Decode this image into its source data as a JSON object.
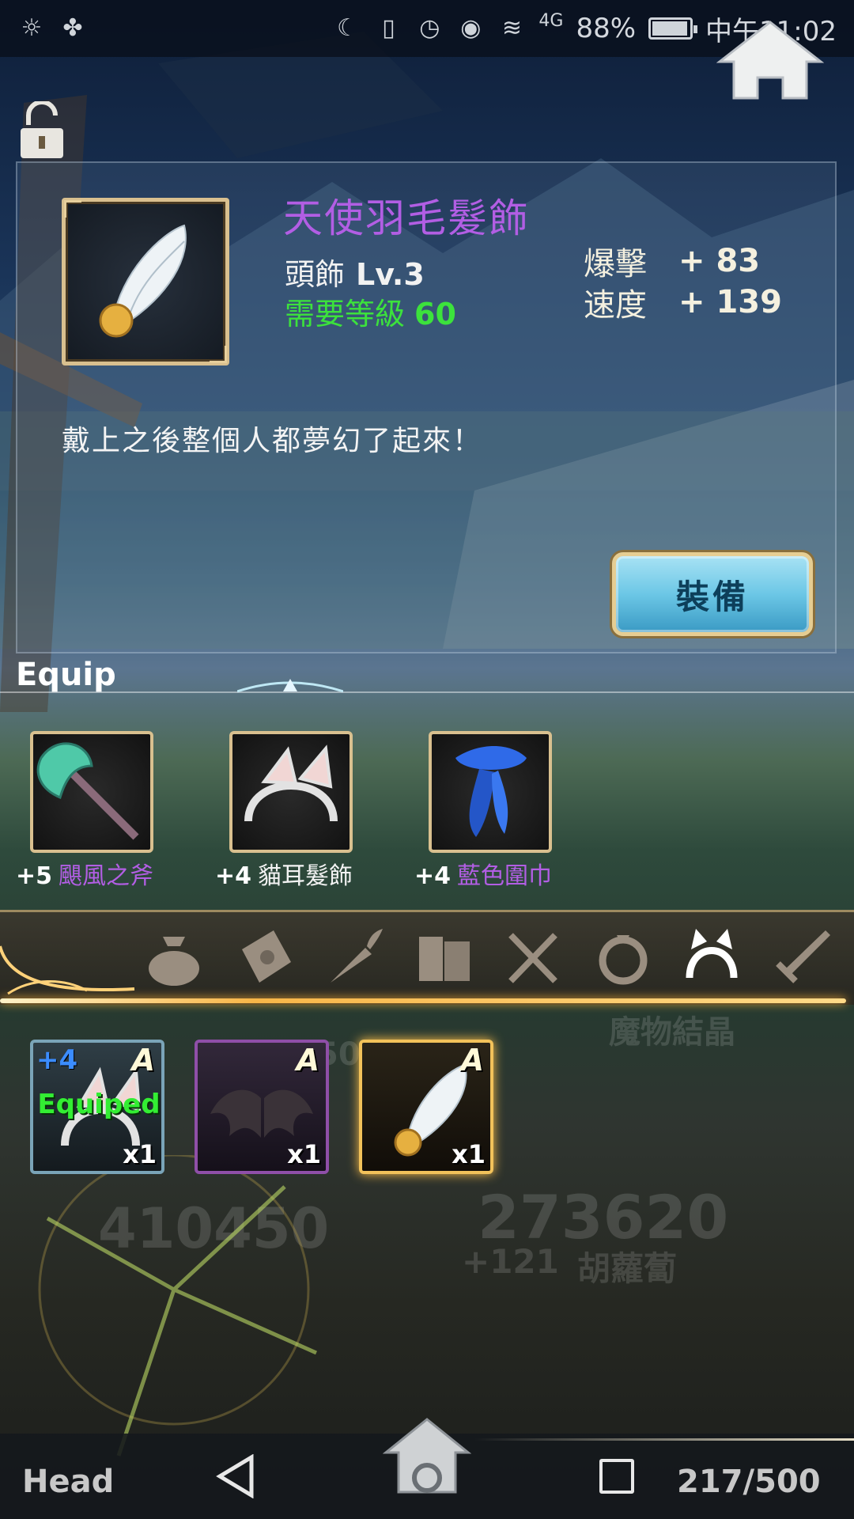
{
  "status_bar": {
    "icons_left": [
      "brightness-icon",
      "app-notification-icon"
    ],
    "icons_right": [
      "moon-icon",
      "vibrate-icon",
      "alarm-icon",
      "eye-icon",
      "wifi-icon",
      "signal-4g-icon"
    ],
    "network_label": "4G",
    "battery": "88%",
    "battery_level": 0.88,
    "time": "中午11:02"
  },
  "item_detail": {
    "name": "天使羽毛髮飾",
    "slot_type": "頭飾",
    "level": "Lv.3",
    "requirement_label": "需要等級",
    "requirement_value": "60",
    "stats": [
      {
        "label": "爆擊",
        "value": "+ 83"
      },
      {
        "label": "速度",
        "value": "+ 139"
      }
    ],
    "description": "戴上之後整個人都夢幻了起來！",
    "equip_button": "裝備"
  },
  "equip_section": {
    "title": "Equip",
    "items": [
      {
        "plus": "+5",
        "name": "颶風之斧",
        "color": "#b25ee4"
      },
      {
        "plus": "+4",
        "name": "貓耳髮飾",
        "color": "#f3f3f3"
      },
      {
        "plus": "+4",
        "name": "藍色圍巾",
        "color": "#b25ee4"
      }
    ]
  },
  "categories": [
    "bag-icon",
    "scroll-icon",
    "carrot-icon",
    "book-icon",
    "utensils-icon",
    "ring-icon",
    "headband-icon",
    "sword-icon"
  ],
  "active_category": "headband-icon",
  "inventory": [
    {
      "plus": "+4",
      "grade": "A",
      "status": "Equiped",
      "qty": "x1"
    },
    {
      "plus": "",
      "grade": "A",
      "status": "",
      "qty": "x1"
    },
    {
      "plus": "",
      "grade": "A",
      "status": "",
      "qty": "x1"
    }
  ],
  "background_text": {
    "a": "魔物結晶",
    "b": "273620",
    "c": "+121",
    "d": "胡蘿蔔",
    "e": "410450",
    "f": "50"
  },
  "footer": {
    "slot_name": "Head",
    "count": "217/500"
  },
  "colors": {
    "purple_rarity": "#b25ee4",
    "green_requirement": "#3ce23c",
    "gold_frame": "#d9c08f",
    "equip_button": "#6cc7e6"
  }
}
